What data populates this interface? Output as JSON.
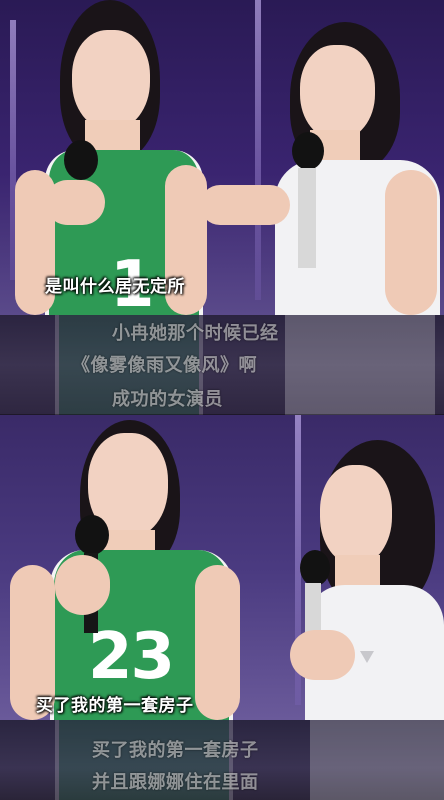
{
  "subtitles": {
    "top_main": "是叫什么居无定所",
    "faded_line_1": "小冉她那个时候已经",
    "faded_line_2": "《像雾像雨又像风》啊",
    "faded_line_3": "成功的女演员",
    "bottom_main": "买了我的第一套房子",
    "faded_line_4": "买了我的第一套房子",
    "faded_line_5": "并且跟娜娜住在里面"
  },
  "jersey": {
    "top_number": "1",
    "bottom_number": "23"
  },
  "colors": {
    "background": "#2a1a55",
    "jersey_green": "#2e9a55",
    "subtitle_white": "#ffffff"
  }
}
